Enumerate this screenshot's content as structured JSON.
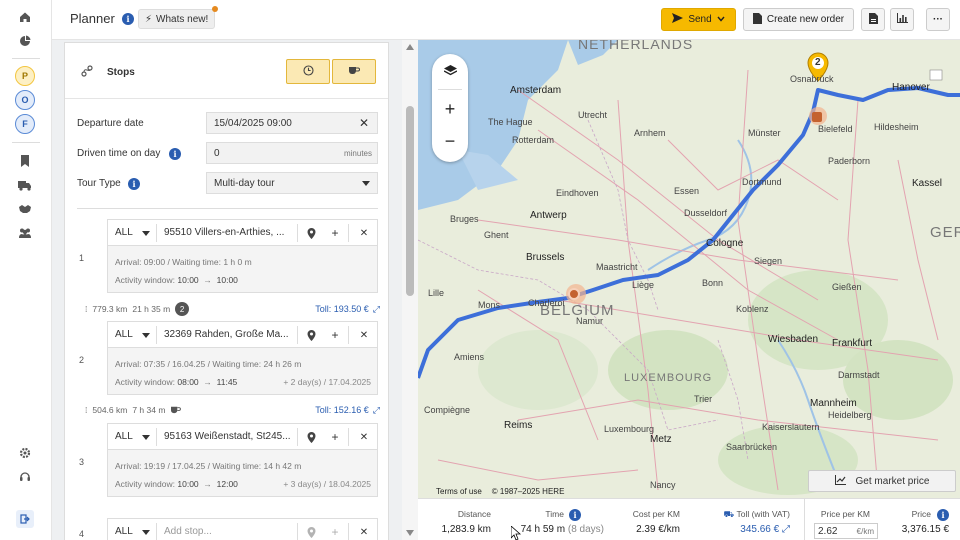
{
  "rail": {
    "avatars": [
      "P",
      "O",
      "F"
    ],
    "colors": {
      "P": "#f3c641",
      "O": "#5b8bd6",
      "F": "#5b8bd6"
    }
  },
  "header": {
    "title": "Planner",
    "whats_new": "Whats new!",
    "send_label": "Send",
    "create_order_label": "Create new order",
    "accent": "#f6b900"
  },
  "stops_panel": {
    "title": "Stops",
    "departure_label": "Departure date",
    "departure_value": "15/04/2025 09:00",
    "driven_label": "Driven time on day",
    "driven_value": "0",
    "driven_unit": "minutes",
    "tour_type_label": "Tour Type",
    "tour_type_value": "Multi-day tour"
  },
  "stops": [
    {
      "num": "1",
      "filter": "ALL",
      "address": "95510 Villers-en-Arthies, ...",
      "arrival": "Arrival: 09:00 / Waiting time: 1 h 0 m",
      "window_label": "Activity window:",
      "window_from": "10:00",
      "window_to": "10:00",
      "extra": ""
    },
    {
      "num": "2",
      "filter": "ALL",
      "address": "32369 Rahden, Große Ma...",
      "arrival": "Arrival: 07:35 / 16.04.25 / Waiting time: 24 h 26 m",
      "window_label": "Activity window:",
      "window_from": "08:00",
      "window_to": "11:45",
      "extra": "+ 2 day(s) / 17.04.2025"
    },
    {
      "num": "3",
      "filter": "ALL",
      "address": "95163 Weißenstadt, St245...",
      "arrival": "Arrival: 19:19 / 17.04.25 / Waiting time: 14 h 42 m",
      "window_label": "Activity window:",
      "window_from": "10:00",
      "window_to": "12:00",
      "extra": "+ 3 day(s) / 18.04.2025"
    },
    {
      "num": "4",
      "filter": "ALL",
      "placeholder": "Add stop..."
    }
  ],
  "legs": [
    {
      "distance": "779.3 km",
      "time": "21 h 35 m",
      "badge": "2",
      "toll": "Toll: 193.50 €"
    },
    {
      "distance": "504.6 km",
      "time": "7 h 34 m",
      "badge": "",
      "toll": "Toll: 152.16 €"
    }
  ],
  "map": {
    "labels": {
      "netherlands": "NETHERLANDS",
      "belgium": "BELGIUM",
      "luxembourg": "LUXEMBOURG",
      "germany": "GERMA",
      "amsterdam": "Amsterdam",
      "the_hague": "The Hague",
      "rotterdam": "Rotterdam",
      "antwerp": "Antwerp",
      "brussels": "Brussels",
      "ghent": "Ghent",
      "bruges": "Bruges",
      "cologne": "Cologne",
      "dusseldorf": "Dusseldorf",
      "dortmund": "Dortmund",
      "essen": "Essen",
      "munster": "Münster",
      "bielefeld": "Bielefeld",
      "hanover": "Hanover",
      "bonn": "Bonn",
      "koblenz": "Koblenz",
      "wiesbaden": "Wiesbaden",
      "frankfurt": "Frankfurt",
      "mannheim": "Mannheim",
      "kassel": "Kassel",
      "liege": "Liège",
      "namur": "Namur",
      "charleroi": "Charleroi",
      "lille": "Lille",
      "reims": "Reims",
      "metz": "Metz",
      "nancy": "Nancy",
      "trier": "Trier",
      "saarbrucken": "Saarbrücken",
      "eindhoven": "Eindhoven",
      "arnhem": "Arnhem",
      "utrecht": "Utrecht",
      "paderborn": "Paderborn",
      "siegen": "Siegen",
      "maastricht": "Maastricht",
      "osnabruck": "Osnabrück",
      "hildesheim": "Hildesheim",
      "giessen": "Gießen",
      "darmstadt": "Darmstadt",
      "kaiserslautern": "Kaiserslautern",
      "luxembourg_city": "Luxembourg",
      "amiens": "Amiens",
      "mons": "Mons",
      "compiegne": "Compiègne",
      "heidelberg": "Heidelberg"
    },
    "marker_label": "2",
    "terms": "Terms of use",
    "copyright": "© 1987–2025 HERE",
    "market_button": "Get market price",
    "route_color": "#3d6fd9"
  },
  "stats": {
    "distance_label": "Distance",
    "distance_value": "1,283.9 km",
    "time_label": "Time",
    "time_value": "74 h 59 m",
    "time_extra": "(8 days)",
    "cost_label": "Cost per KM",
    "cost_value": "2.39 €/km",
    "toll_label": "Toll (with VAT)",
    "toll_value": "345.66 €",
    "ppk_label": "Price per KM",
    "ppk_value": "2.62",
    "ppk_unit": "€/km",
    "price_label": "Price",
    "price_value": "3,376.15 €"
  }
}
